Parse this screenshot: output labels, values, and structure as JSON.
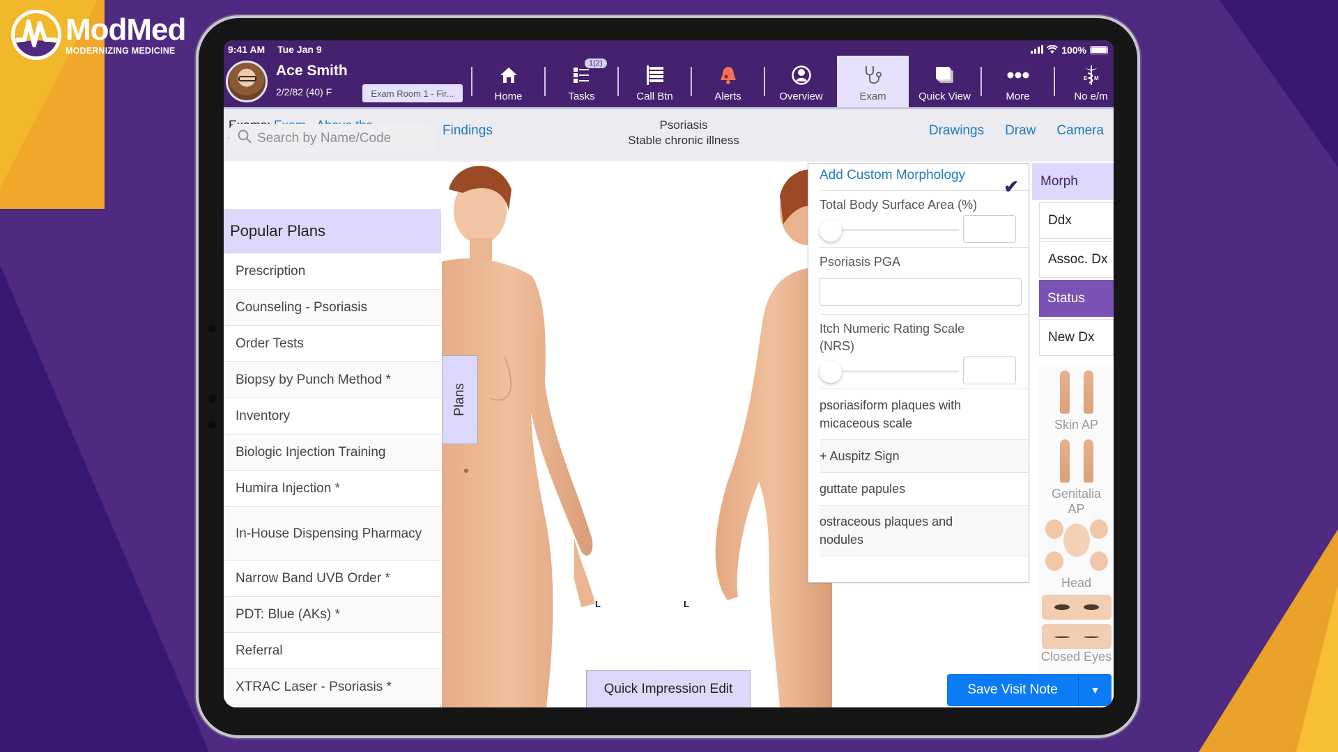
{
  "brand": {
    "name": "ModMed",
    "tagline": "MODERNIZING MEDICINE",
    "colors": {
      "purple": "#4e2b80",
      "yellow": "#f2b82c",
      "dark_purple": "#371873"
    }
  },
  "status_bar": {
    "time": "9:41 AM",
    "date": "Tue Jan 9",
    "battery": "100%",
    "icons": [
      "signal-icon",
      "wifi-icon",
      "battery-icon"
    ]
  },
  "patient": {
    "name": "Ace Smith",
    "dob_age_sex": "2/2/82 (40) F",
    "room": "Exam Room 1 - Fir..."
  },
  "nav": {
    "items": [
      {
        "label": "Home",
        "icon": "home-icon"
      },
      {
        "label": "Tasks",
        "icon": "tasks-icon",
        "badge": "1(2)"
      },
      {
        "label": "Call Btn",
        "icon": "call-button-icon"
      },
      {
        "label": "Alerts",
        "icon": "bell-icon"
      },
      {
        "label": "Overview",
        "icon": "person-icon"
      },
      {
        "label": "Exam",
        "icon": "stethoscope-icon",
        "active": true
      },
      {
        "label": "Quick View",
        "icon": "quick-view-icon"
      },
      {
        "label": "More",
        "icon": "more-icon"
      },
      {
        "label": "No e/m",
        "icon": "caduceus-icon"
      }
    ]
  },
  "subbar": {
    "exams_label": "Exams:",
    "exam_name": "Exam - Above the Waist",
    "findings": "Findings",
    "diagnosis": "Psoriasis",
    "diagnosis_status": "Stable chronic illness",
    "drawings": "Drawings",
    "draw": "Draw",
    "camera": "Camera"
  },
  "plans_panel": {
    "search_placeholder": "Search by Name/Code",
    "header": "Popular Plans",
    "items": [
      "Prescription",
      "Counseling - Psoriasis",
      "Order Tests",
      "Biopsy by Punch Method *",
      "Inventory",
      "Biologic Injection Training",
      "Humira Injection *",
      "In-House Dispensing Pharmacy",
      "Narrow Band UVB Order *",
      "PDT: Blue (AKs) *",
      "Referral",
      "XTRAC Laser - Psoriasis *"
    ],
    "tab_label": "Plans"
  },
  "body_map": {
    "left_marker": "L",
    "right_marker": "L"
  },
  "morph_panel": {
    "add_custom": "Add Custom Morphology",
    "tbsa_label": "Total Body Surface Area (%)",
    "tbsa_value": "",
    "tbsa_slider_fraction": 0,
    "pga_label": "Psoriasis PGA",
    "pga_value": "",
    "nrs_label": "Itch Numeric Rating Scale (NRS)",
    "nrs_value": "",
    "nrs_slider_fraction": 0,
    "options": [
      {
        "label": "psoriasiform plaques with micaceous scale",
        "checked": true
      },
      {
        "label": "+ Auspitz Sign",
        "checked": false
      },
      {
        "label": "guttate papules",
        "checked": false
      },
      {
        "label": "ostraceous plaques and nodules",
        "checked": false
      }
    ]
  },
  "right_tabs": {
    "items": [
      {
        "label": "Morph",
        "state": "header"
      },
      {
        "label": "Ddx"
      },
      {
        "label": "Assoc. Dx"
      },
      {
        "label": "Status",
        "state": "active"
      },
      {
        "label": "New Dx"
      }
    ]
  },
  "thumbnails": [
    {
      "label": "Skin AP"
    },
    {
      "label": "Genitalia AP"
    },
    {
      "label": "Head"
    },
    {
      "label": "Eyes"
    },
    {
      "label": "Closed Eyes"
    }
  ],
  "footer": {
    "quick_impression": "Quick Impression Edit",
    "save_visit_note": "Save Visit Note"
  }
}
